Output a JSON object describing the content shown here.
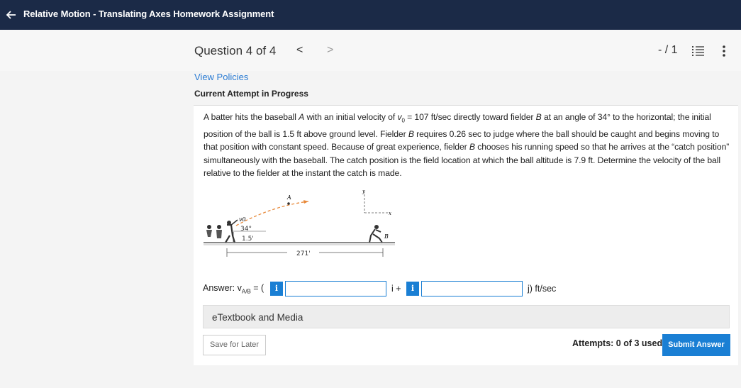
{
  "topbar": {
    "title": "Relative Motion - Translating Axes Homework Assignment"
  },
  "question": {
    "title": "Question 4 of 4",
    "prev_glyph": "<",
    "next_glyph": ">",
    "score": "- / 1"
  },
  "view_policies": "View Policies",
  "attempt_status": "Current Attempt in Progress",
  "problem": {
    "t1": "A batter hits the baseball ",
    "t2": "A",
    "t3": " with an initial velocity of ",
    "t4": "v",
    "t5": "0",
    "t6": " = 107 ft/sec directly toward fielder ",
    "t7": "B",
    "t8": " at an angle of 34° to the horizontal; the initial position of the ball is 1.5 ft above ground level. Fielder ",
    "t9": "B",
    "t10": " requires 0.26 sec to judge where the ball should be caught and begins moving to that position with constant speed. Because of great experience, fielder ",
    "t11": "B",
    "t12": " chooses his running speed so that he arrives at the “catch position” simultaneously with the baseball. The catch position is the field location at which the ball altitude is 7.9 ft. Determine the velocity of the ball relative to the fielder at the instant the catch is made."
  },
  "figure": {
    "angle_label": "34°",
    "height_label": "1.5'",
    "distance_label": "271'",
    "v0_label": "v0",
    "ball_label": "A",
    "fielder_label": "B",
    "x_axis_label": "x",
    "y_axis_label": "y"
  },
  "answer": {
    "prefix": "Answer: v",
    "subscript": "A/B",
    "open": " = (",
    "info_glyph": "i",
    "i_unit": "i +",
    "j_unit": "j) ft/sec",
    "input_i_value": "",
    "input_j_value": ""
  },
  "etextbook": "eTextbook and Media",
  "save_later": "Save for Later",
  "attempts": "Attempts: 0 of 3 used",
  "submit": "Submit Answer",
  "colors": {
    "topbar": "#1b2a47",
    "accent": "#1a7fd4",
    "link": "#2a7bd3"
  }
}
